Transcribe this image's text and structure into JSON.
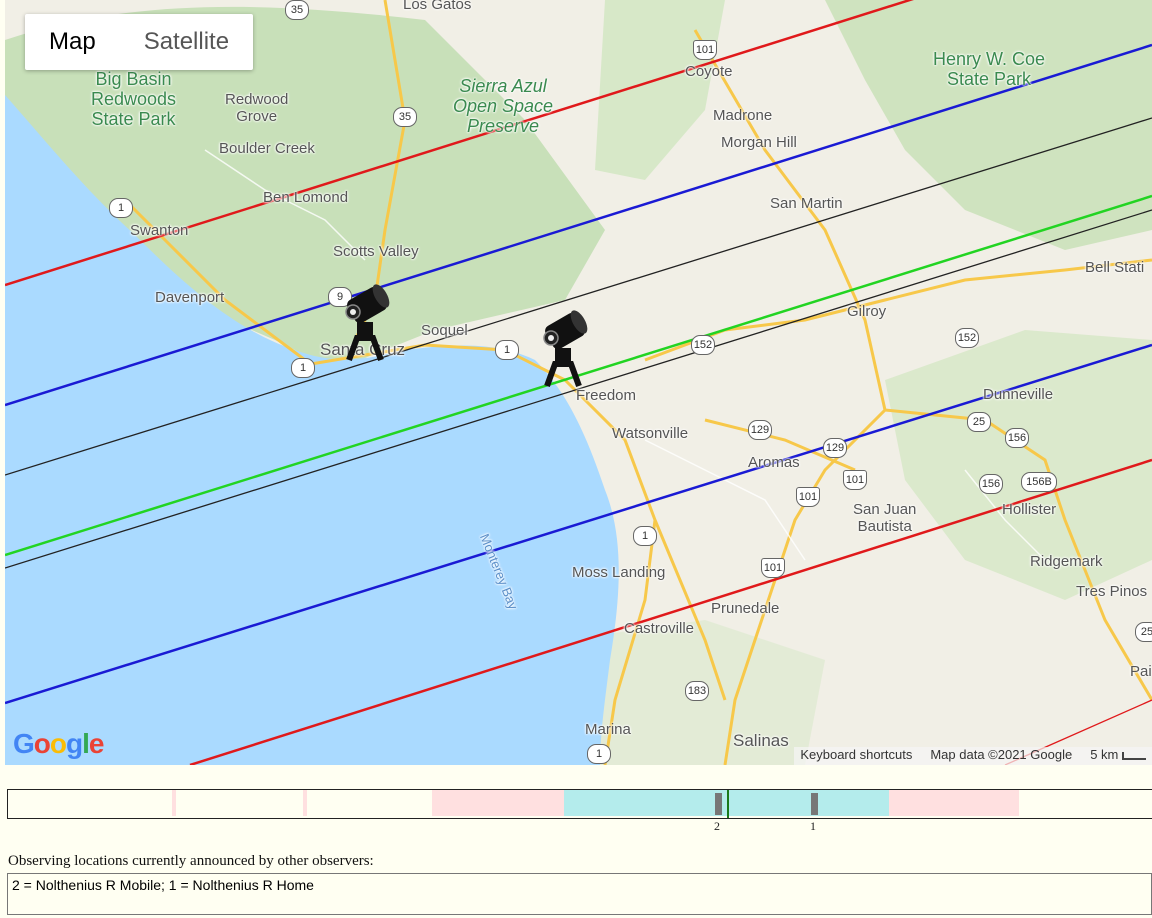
{
  "map": {
    "type_control": {
      "map_label": "Map",
      "satellite_label": "Satellite",
      "active": "Map"
    },
    "logo_text": "Google",
    "attribution": {
      "keyboard_shortcuts": "Keyboard shortcuts",
      "map_data": "Map data ©2021 Google",
      "scale": "5 km"
    },
    "places": [
      {
        "name": "Los Gatos",
        "kind": "city"
      },
      {
        "name": "Big Basin\nRedwoods\nState Park",
        "kind": "park"
      },
      {
        "name": "Redwood\nGrove",
        "kind": "city"
      },
      {
        "name": "Sierra Azul\nOpen Space\nPreserve",
        "kind": "park"
      },
      {
        "name": "Coyote",
        "kind": "city"
      },
      {
        "name": "Henry W. Coe\nState Park",
        "kind": "park"
      },
      {
        "name": "Madrone",
        "kind": "city"
      },
      {
        "name": "Morgan Hill",
        "kind": "city"
      },
      {
        "name": "Boulder Creek",
        "kind": "city"
      },
      {
        "name": "Ben Lomond",
        "kind": "city"
      },
      {
        "name": "Swanton",
        "kind": "city"
      },
      {
        "name": "San Martin",
        "kind": "city"
      },
      {
        "name": "Scotts Valley",
        "kind": "city"
      },
      {
        "name": "Bell Stati",
        "kind": "city"
      },
      {
        "name": "Davenport",
        "kind": "city"
      },
      {
        "name": "Gilroy",
        "kind": "city"
      },
      {
        "name": "Soquel",
        "kind": "city"
      },
      {
        "name": "Santa Cruz",
        "kind": "city"
      },
      {
        "name": "Dunneville",
        "kind": "city"
      },
      {
        "name": "Freedom",
        "kind": "city"
      },
      {
        "name": "Watsonville",
        "kind": "city"
      },
      {
        "name": "Aromas",
        "kind": "city"
      },
      {
        "name": "San Juan\nBautista",
        "kind": "city"
      },
      {
        "name": "Hollister",
        "kind": "city"
      },
      {
        "name": "Ridgemark",
        "kind": "city"
      },
      {
        "name": "Tres Pinos",
        "kind": "city"
      },
      {
        "name": "Moss Landing",
        "kind": "city"
      },
      {
        "name": "Prunedale",
        "kind": "city"
      },
      {
        "name": "Castroville",
        "kind": "city"
      },
      {
        "name": "Pai",
        "kind": "city"
      },
      {
        "name": "Marina",
        "kind": "city"
      },
      {
        "name": "Salinas",
        "kind": "city"
      },
      {
        "name": "Monterey Bay",
        "kind": "water"
      }
    ],
    "route_shields": [
      "35",
      "101",
      "35",
      "1",
      "9",
      "1",
      "1",
      "152",
      "152",
      "129",
      "129",
      "101",
      "101",
      "25",
      "156",
      "156",
      "156B",
      "1",
      "101",
      "183",
      "1",
      "25"
    ],
    "path_lines": [
      {
        "color": "#e0191b",
        "role": "outer-limit"
      },
      {
        "color": "#1a1ad4",
        "role": "inner-limit"
      },
      {
        "color": "#222222",
        "role": "centerline-bound"
      },
      {
        "color": "#22d422",
        "role": "centerline"
      }
    ],
    "markers": [
      {
        "name": "observer-telescope",
        "id": "2"
      },
      {
        "name": "observer-telescope",
        "id": "1"
      }
    ]
  },
  "timeline": {
    "segment_colors": {
      "outer": "#ffe0e0",
      "inner": "#b4ecec",
      "base": "#fffff2"
    },
    "tick_labels": [
      "2",
      "1"
    ]
  },
  "observers": {
    "heading": "Observing locations currently announced by other observers:",
    "list_text": "2 = Nolthenius R Mobile; 1 = Nolthenius R Home"
  }
}
